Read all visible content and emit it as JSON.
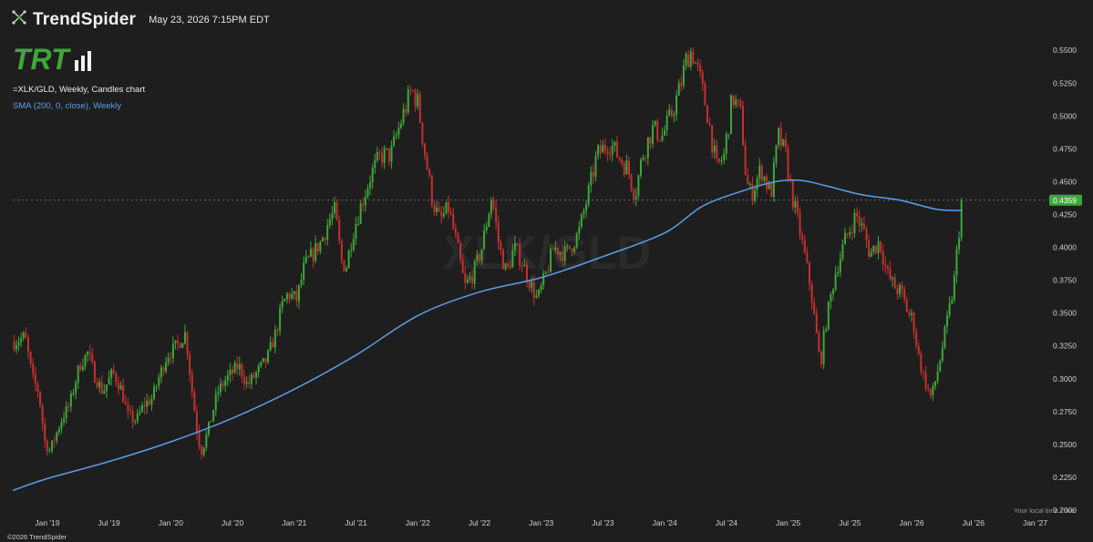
{
  "header": {
    "brand": "TrendSpider",
    "timestamp": "May 23, 2026 7:15PM EDT",
    "logo_text": "TRT",
    "legend_main": "=XLK/GLD, Weekly, Candles chart",
    "legend_sma": "SMA (200, 0, close), Weekly"
  },
  "footer": {
    "copyright": "©2026 TrendSpider",
    "local_time_zone": "Your local time zone"
  },
  "colors": {
    "background": "#1e1e1e",
    "up": "#3fa73a",
    "down": "#c6302f",
    "sma": "#5b9ee8",
    "last_price_badge": "#3fa73a",
    "grid_dash": "#8a8a8a"
  },
  "chart_data": {
    "type": "candlestick",
    "symbol": "=XLK/GLD",
    "interval": "Weekly",
    "x_ticks": [
      "Jan '19",
      "Jul '19",
      "Jan '20",
      "Jul '20",
      "Jan '21",
      "Jul '21",
      "Jan '22",
      "Jul '22",
      "Jan '23",
      "Jul '23",
      "Jan '24",
      "Jul '24",
      "Jan '25",
      "Jul '25",
      "Jan '26",
      "Jul '26",
      "Jan '27"
    ],
    "y_ticks": [
      "0.2000",
      "0.2250",
      "0.2500",
      "0.2750",
      "0.3000",
      "0.3250",
      "0.3500",
      "0.3750",
      "0.4000",
      "0.4250",
      "0.4500",
      "0.4750",
      "0.5000",
      "0.5250",
      "0.5500"
    ],
    "ylim": [
      0.2,
      0.555
    ],
    "xlim": [
      2018.72,
      2027.07
    ],
    "last_price": "0.4359",
    "price_path": [
      [
        2018.73,
        0.328
      ],
      [
        2018.82,
        0.332
      ],
      [
        2018.88,
        0.3
      ],
      [
        2018.93,
        0.29
      ],
      [
        2018.98,
        0.252
      ],
      [
        2019.02,
        0.245
      ],
      [
        2019.06,
        0.255
      ],
      [
        2019.12,
        0.27
      ],
      [
        2019.18,
        0.28
      ],
      [
        2019.26,
        0.31
      ],
      [
        2019.33,
        0.32
      ],
      [
        2019.38,
        0.303
      ],
      [
        2019.45,
        0.29
      ],
      [
        2019.53,
        0.305
      ],
      [
        2019.6,
        0.292
      ],
      [
        2019.65,
        0.272
      ],
      [
        2019.72,
        0.268
      ],
      [
        2019.78,
        0.28
      ],
      [
        2019.85,
        0.285
      ],
      [
        2019.9,
        0.3
      ],
      [
        2019.97,
        0.318
      ],
      [
        2020.05,
        0.325
      ],
      [
        2020.12,
        0.335
      ],
      [
        2020.16,
        0.3
      ],
      [
        2020.22,
        0.255
      ],
      [
        2020.25,
        0.245
      ],
      [
        2020.3,
        0.26
      ],
      [
        2020.38,
        0.29
      ],
      [
        2020.45,
        0.3
      ],
      [
        2020.55,
        0.31
      ],
      [
        2020.62,
        0.295
      ],
      [
        2020.7,
        0.305
      ],
      [
        2020.78,
        0.315
      ],
      [
        2020.85,
        0.335
      ],
      [
        2020.9,
        0.355
      ],
      [
        2020.95,
        0.365
      ],
      [
        2021.02,
        0.36
      ],
      [
        2021.08,
        0.385
      ],
      [
        2021.15,
        0.395
      ],
      [
        2021.22,
        0.405
      ],
      [
        2021.28,
        0.42
      ],
      [
        2021.33,
        0.428
      ],
      [
        2021.38,
        0.39
      ],
      [
        2021.42,
        0.385
      ],
      [
        2021.47,
        0.41
      ],
      [
        2021.55,
        0.435
      ],
      [
        2021.62,
        0.455
      ],
      [
        2021.7,
        0.47
      ],
      [
        2021.78,
        0.47
      ],
      [
        2021.86,
        0.495
      ],
      [
        2021.95,
        0.52
      ],
      [
        2022.0,
        0.51
      ],
      [
        2022.06,
        0.47
      ],
      [
        2022.12,
        0.435
      ],
      [
        2022.18,
        0.42
      ],
      [
        2022.25,
        0.43
      ],
      [
        2022.32,
        0.4
      ],
      [
        2022.38,
        0.37
      ],
      [
        2022.45,
        0.38
      ],
      [
        2022.52,
        0.4
      ],
      [
        2022.6,
        0.44
      ],
      [
        2022.66,
        0.4
      ],
      [
        2022.72,
        0.38
      ],
      [
        2022.78,
        0.4
      ],
      [
        2022.84,
        0.39
      ],
      [
        2022.9,
        0.375
      ],
      [
        2022.97,
        0.36
      ],
      [
        2023.04,
        0.38
      ],
      [
        2023.1,
        0.4
      ],
      [
        2023.2,
        0.395
      ],
      [
        2023.3,
        0.41
      ],
      [
        2023.38,
        0.44
      ],
      [
        2023.45,
        0.47
      ],
      [
        2023.55,
        0.48
      ],
      [
        2023.62,
        0.47
      ],
      [
        2023.7,
        0.46
      ],
      [
        2023.76,
        0.44
      ],
      [
        2023.82,
        0.47
      ],
      [
        2023.9,
        0.49
      ],
      [
        2023.98,
        0.485
      ],
      [
        2024.05,
        0.5
      ],
      [
        2024.12,
        0.52
      ],
      [
        2024.18,
        0.545
      ],
      [
        2024.22,
        0.55
      ],
      [
        2024.28,
        0.53
      ],
      [
        2024.35,
        0.5
      ],
      [
        2024.42,
        0.46
      ],
      [
        2024.48,
        0.47
      ],
      [
        2024.55,
        0.515
      ],
      [
        2024.62,
        0.5
      ],
      [
        2024.66,
        0.45
      ],
      [
        2024.7,
        0.44
      ],
      [
        2024.78,
        0.46
      ],
      [
        2024.86,
        0.44
      ],
      [
        2024.92,
        0.485
      ],
      [
        2024.98,
        0.47
      ],
      [
        2025.03,
        0.44
      ],
      [
        2025.1,
        0.41
      ],
      [
        2025.18,
        0.37
      ],
      [
        2025.22,
        0.34
      ],
      [
        2025.26,
        0.31
      ],
      [
        2025.3,
        0.34
      ],
      [
        2025.38,
        0.38
      ],
      [
        2025.46,
        0.405
      ],
      [
        2025.55,
        0.425
      ],
      [
        2025.62,
        0.41
      ],
      [
        2025.66,
        0.395
      ],
      [
        2025.74,
        0.405
      ],
      [
        2025.8,
        0.38
      ],
      [
        2025.86,
        0.37
      ],
      [
        2025.92,
        0.365
      ],
      [
        2025.97,
        0.35
      ],
      [
        2026.01,
        0.345
      ],
      [
        2026.05,
        0.32
      ],
      [
        2026.1,
        0.3
      ],
      [
        2026.16,
        0.285
      ],
      [
        2026.22,
        0.31
      ],
      [
        2026.28,
        0.34
      ],
      [
        2026.34,
        0.37
      ],
      [
        2026.38,
        0.41
      ],
      [
        2026.41,
        0.436
      ]
    ],
    "sma_path": [
      [
        2018.72,
        0.215
      ],
      [
        2019.0,
        0.224
      ],
      [
        2019.5,
        0.237
      ],
      [
        2020.0,
        0.252
      ],
      [
        2020.5,
        0.27
      ],
      [
        2021.0,
        0.292
      ],
      [
        2021.5,
        0.318
      ],
      [
        2022.0,
        0.348
      ],
      [
        2022.5,
        0.366
      ],
      [
        2023.0,
        0.377
      ],
      [
        2023.5,
        0.393
      ],
      [
        2024.0,
        0.411
      ],
      [
        2024.3,
        0.431
      ],
      [
        2024.6,
        0.442
      ],
      [
        2024.9,
        0.45
      ],
      [
        2025.1,
        0.451
      ],
      [
        2025.3,
        0.447
      ],
      [
        2025.6,
        0.44
      ],
      [
        2025.9,
        0.436
      ],
      [
        2026.2,
        0.429
      ],
      [
        2026.41,
        0.428
      ]
    ]
  }
}
